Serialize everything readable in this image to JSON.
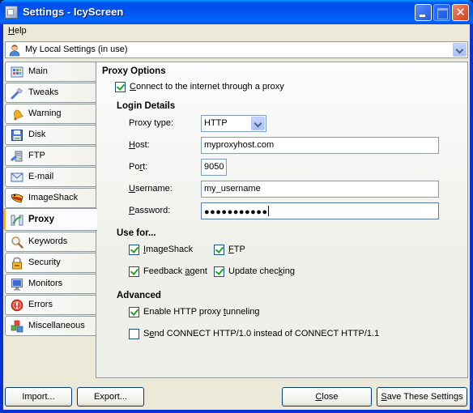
{
  "window": {
    "title": "Settings - IcyScreen",
    "controls": [
      "minimize",
      "maximize",
      "close"
    ]
  },
  "menu": {
    "help": "Help",
    "help_mnemonic": "H",
    "help_rest": "elp"
  },
  "profile": {
    "selected": "My Local Settings (in use)",
    "icon": "user-icon"
  },
  "tabs": [
    {
      "label": "Main",
      "icon": "main-grid-icon",
      "active": false
    },
    {
      "label": "Tweaks",
      "icon": "wrench-icon",
      "active": false
    },
    {
      "label": "Warning",
      "icon": "bell-icon",
      "active": false
    },
    {
      "label": "Disk",
      "icon": "floppy-disk-icon",
      "active": false
    },
    {
      "label": "FTP",
      "icon": "ftp-icon",
      "active": false
    },
    {
      "label": "E-mail",
      "icon": "envelope-icon",
      "active": false
    },
    {
      "label": "ImageShack",
      "icon": "imageshack-frog-icon",
      "active": false
    },
    {
      "label": "Proxy",
      "icon": "proxy-network-icon",
      "active": true
    },
    {
      "label": "Keywords",
      "icon": "magnifier-icon",
      "active": false
    },
    {
      "label": "Security",
      "icon": "padlock-icon",
      "active": false
    },
    {
      "label": "Monitors",
      "icon": "monitor-icon",
      "active": false
    },
    {
      "label": "Errors",
      "icon": "error-icon",
      "active": false
    },
    {
      "label": "Miscellaneous",
      "icon": "cubes-icon",
      "active": false
    }
  ],
  "proxy": {
    "section_title": "Proxy Options",
    "connect": {
      "label": "Connect to the internet through a proxy",
      "checked": true
    },
    "login": {
      "title": "Login Details",
      "proxy_type_label": "Proxy type:",
      "proxy_type_value": "HTTP",
      "host_label": "Host:",
      "host_value": "myproxyhost.com",
      "port_label": "Port:",
      "port_value": "9050",
      "username_label": "Username:",
      "username_value": "my_username",
      "password_label": "Password:",
      "password_value": "●●●●●●●●●●●"
    },
    "use_for": {
      "title": "Use for...",
      "items": [
        {
          "label": "ImageShack",
          "checked": true
        },
        {
          "label": "FTP",
          "checked": true
        },
        {
          "label": "Feedback agent",
          "checked": true
        },
        {
          "label": "Update checking",
          "checked": true
        }
      ]
    },
    "advanced": {
      "title": "Advanced",
      "items": [
        {
          "label": "Enable HTTP proxy tunneling",
          "checked": true
        },
        {
          "label": "Send CONNECT HTTP/1.0 instead of CONNECT HTTP/1.1",
          "checked": false
        }
      ]
    }
  },
  "buttons": {
    "import": "Import...",
    "export": "Export...",
    "close": "Close",
    "save": "Save These Settings"
  }
}
